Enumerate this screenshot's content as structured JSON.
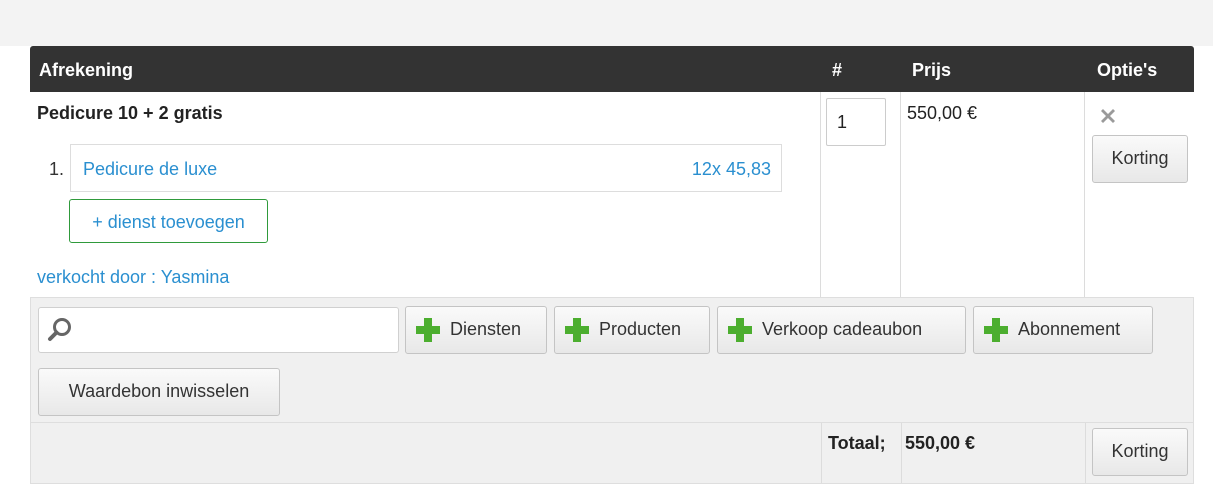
{
  "table": {
    "headers": {
      "checkout": "Afrekening",
      "qty": "#",
      "price": "Prijs",
      "options": "Optie's"
    }
  },
  "line": {
    "title": "Pedicure 10 + 2 gratis",
    "quantity": "1",
    "price": "550,00 €",
    "discount_label": "Korting",
    "remove_icon": "close-x-icon",
    "services": [
      {
        "number": "1.",
        "name": "Pedicure de luxe",
        "price": "12x 45,83"
      }
    ],
    "add_service_label": "+ dienst toevoegen",
    "sold_by": "verkocht door : Yasmina"
  },
  "toolbar": {
    "search_value": "",
    "search_icon": "magnifier-icon",
    "buttons": {
      "services": "Diensten",
      "products": "Producten",
      "gift_card": "Verkoop cadeaubon",
      "subscription": "Abonnement"
    },
    "plus_icon": "green-plus-icon",
    "voucher": "Waardebon inwisselen"
  },
  "totals": {
    "label": "Totaal;",
    "value": "550,00 €",
    "discount_label": "Korting"
  },
  "colors": {
    "header_bg": "#333333",
    "link": "#2a8fd0",
    "plus": "#4cae2f",
    "add_border": "#2f9a3b"
  }
}
